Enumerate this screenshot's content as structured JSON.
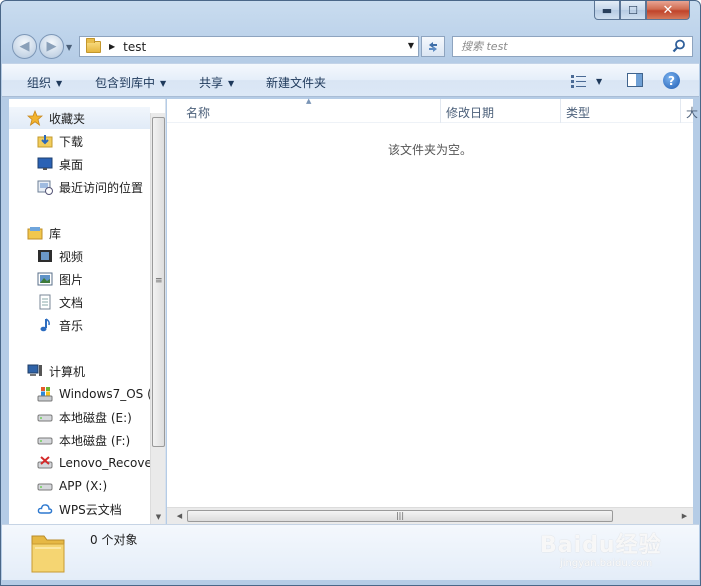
{
  "window": {
    "caption_buttons": [
      {
        "name": "minimize-button",
        "glyph": "▬"
      },
      {
        "name": "maximize-button",
        "glyph": "☐"
      },
      {
        "name": "close-button",
        "glyph": "✕"
      }
    ]
  },
  "address": {
    "crumb": "test",
    "search_placeholder": "搜索 test"
  },
  "toolbar": {
    "organize": "组织",
    "include_in_library": "包含到库中",
    "share": "共享",
    "new_folder": "新建文件夹"
  },
  "sidebar": {
    "favorites": {
      "label": "收藏夹",
      "icon": "star-icon"
    },
    "favorites_items": [
      {
        "label": "下载",
        "icon": "download-folder-icon"
      },
      {
        "label": "桌面",
        "icon": "desktop-icon"
      },
      {
        "label": "最近访问的位置",
        "icon": "recent-places-icon"
      }
    ],
    "libraries": {
      "label": "库",
      "icon": "library-icon"
    },
    "libraries_items": [
      {
        "label": "视频",
        "icon": "video-icon"
      },
      {
        "label": "图片",
        "icon": "pictures-icon"
      },
      {
        "label": "文档",
        "icon": "documents-icon"
      },
      {
        "label": "音乐",
        "icon": "music-icon"
      }
    ],
    "computer": {
      "label": "计算机",
      "icon": "computer-icon"
    },
    "computer_items": [
      {
        "label": "Windows7_OS (",
        "icon": "windows-drive-icon"
      },
      {
        "label": "本地磁盘 (E:)",
        "icon": "drive-icon"
      },
      {
        "label": "本地磁盘 (F:)",
        "icon": "drive-icon"
      },
      {
        "label": "Lenovo_Recove",
        "icon": "recovery-drive-icon"
      },
      {
        "label": "APP (X:)",
        "icon": "drive-icon"
      },
      {
        "label": "WPS云文档",
        "icon": "cloud-icon"
      }
    ]
  },
  "content": {
    "columns": [
      "名称",
      "修改日期",
      "类型",
      "大"
    ],
    "empty_message": "该文件夹为空。"
  },
  "details": {
    "item_count": "0 个对象"
  },
  "watermark": {
    "text": "Baidu经验",
    "sub": "jingyan.baidu.com"
  }
}
